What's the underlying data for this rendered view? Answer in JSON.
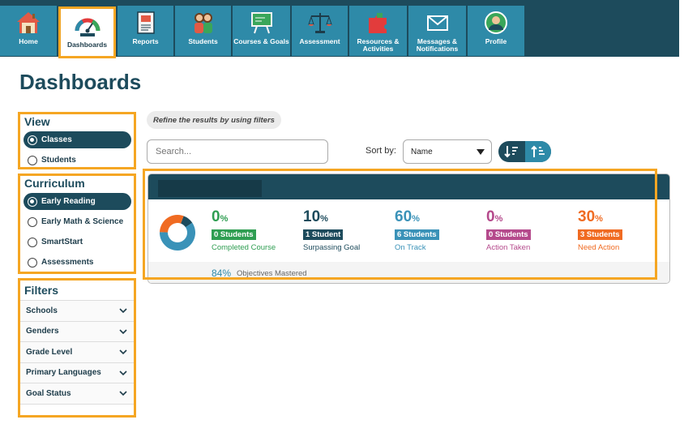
{
  "nav": [
    {
      "label": "Home",
      "icon": "home-icon"
    },
    {
      "label": "Dashboards",
      "icon": "gauge-icon",
      "active": true
    },
    {
      "label": "Reports",
      "icon": "report-icon"
    },
    {
      "label": "Students",
      "icon": "students-icon"
    },
    {
      "label": "Courses & Goals",
      "icon": "chalkboard-icon"
    },
    {
      "label": "Assessment",
      "icon": "scales-icon"
    },
    {
      "label": "Resources &\nActivities",
      "icon": "puzzle-icon"
    },
    {
      "label": "Messages &\nNotifications",
      "icon": "envelope-icon"
    },
    {
      "label": "Profile",
      "icon": "profile-icon"
    }
  ],
  "page_title": "Dashboards",
  "view": {
    "title": "View",
    "options": [
      {
        "label": "Classes",
        "selected": true
      },
      {
        "label": "Students",
        "selected": false
      }
    ]
  },
  "curriculum": {
    "title": "Curriculum",
    "options": [
      {
        "label": "Early Reading",
        "selected": true
      },
      {
        "label": "Early Math & Science",
        "selected": false
      },
      {
        "label": "SmartStart",
        "selected": false
      },
      {
        "label": "Assessments",
        "selected": false
      }
    ]
  },
  "filters": {
    "title": "Filters",
    "items": [
      "Schools",
      "Genders",
      "Grade Level",
      "Primary Languages",
      "Goal Status"
    ]
  },
  "refine_text": "Refine the results by using filters",
  "search": {
    "placeholder": "Search..."
  },
  "sort": {
    "label": "Sort by:",
    "value": "Name"
  },
  "card": {
    "donut": [
      {
        "name": "Surpassing Goal",
        "value": 10,
        "color": "#1d4b5c"
      },
      {
        "name": "On Track",
        "value": 60,
        "color": "#3a92b8"
      },
      {
        "name": "Need Action",
        "value": 30,
        "color": "#f06b22"
      }
    ],
    "stats": [
      {
        "pct": "0",
        "badge": "0 Students",
        "caption": "Completed Course",
        "color": "#2f9e52"
      },
      {
        "pct": "10",
        "badge": "1 Student",
        "caption": "Surpassing Goal",
        "color": "#1d4b5c"
      },
      {
        "pct": "60",
        "badge": "6 Students",
        "caption": "On Track",
        "color": "#3a92b8"
      },
      {
        "pct": "0",
        "badge": "0 Students",
        "caption": "Action Taken",
        "color": "#b54a8c"
      },
      {
        "pct": "30",
        "badge": "3 Students",
        "caption": "Need Action",
        "color": "#f06b22"
      }
    ],
    "objectives_value": "84%",
    "objectives_label": "Objectives Mastered"
  }
}
